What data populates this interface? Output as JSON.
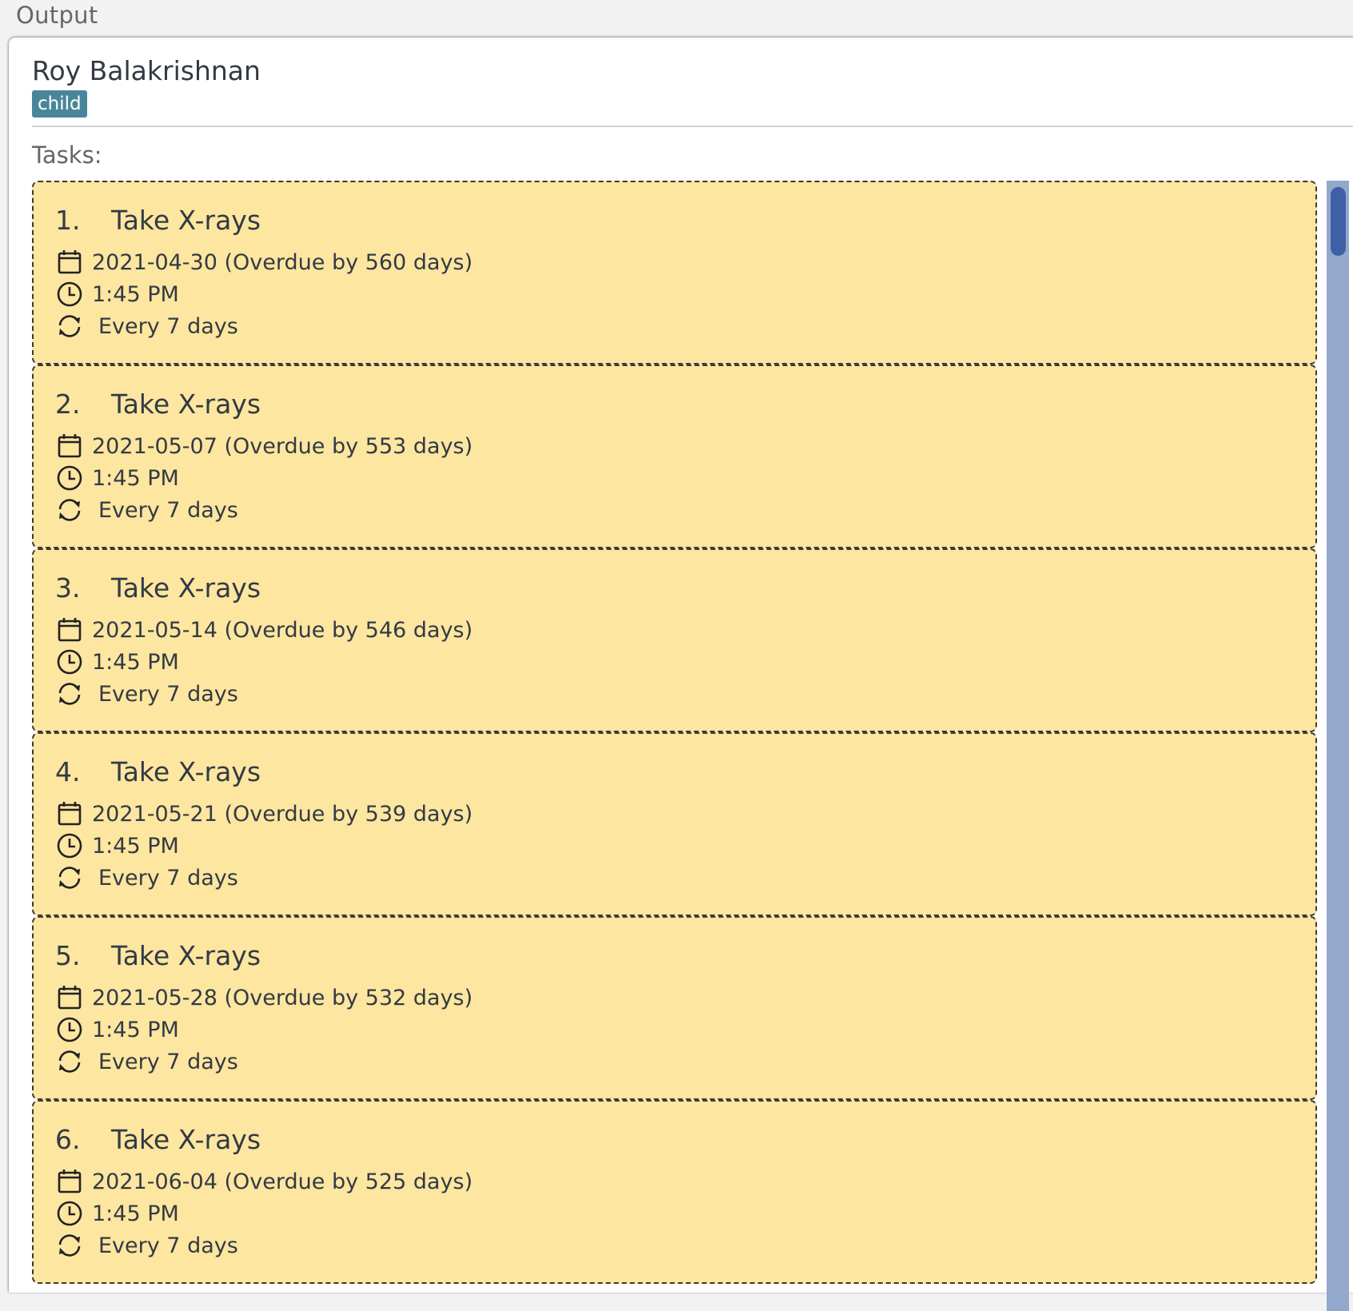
{
  "window": {
    "section_title": "Output"
  },
  "person": {
    "name": "Roy Balakrishnan",
    "tag": "child"
  },
  "tasks_label": "Tasks:",
  "tasks": [
    {
      "index": "1.",
      "title": "Take X-rays",
      "date": "2021-04-30 (Overdue by 560 days)",
      "time": "1:45 PM",
      "recurrence": "Every 7 days"
    },
    {
      "index": "2.",
      "title": "Take X-rays",
      "date": "2021-05-07 (Overdue by 553 days)",
      "time": "1:45 PM",
      "recurrence": "Every 7 days"
    },
    {
      "index": "3.",
      "title": "Take X-rays",
      "date": "2021-05-14 (Overdue by 546 days)",
      "time": "1:45 PM",
      "recurrence": "Every 7 days"
    },
    {
      "index": "4.",
      "title": "Take X-rays",
      "date": "2021-05-21 (Overdue by 539 days)",
      "time": "1:45 PM",
      "recurrence": "Every 7 days"
    },
    {
      "index": "5.",
      "title": "Take X-rays",
      "date": "2021-05-28 (Overdue by 532 days)",
      "time": "1:45 PM",
      "recurrence": "Every 7 days"
    },
    {
      "index": "6.",
      "title": "Take X-rays",
      "date": "2021-06-04 (Overdue by 525 days)",
      "time": "1:45 PM",
      "recurrence": "Every 7 days"
    }
  ],
  "icons": {
    "date": "calendar-icon",
    "time": "clock-icon",
    "recurrence": "repeat-icon"
  },
  "colors": {
    "card_background": "#fde6a0",
    "tag_background": "#4a8699",
    "scrollbar_track": "#94a8cc",
    "scrollbar_thumb": "#3f5fa7"
  }
}
